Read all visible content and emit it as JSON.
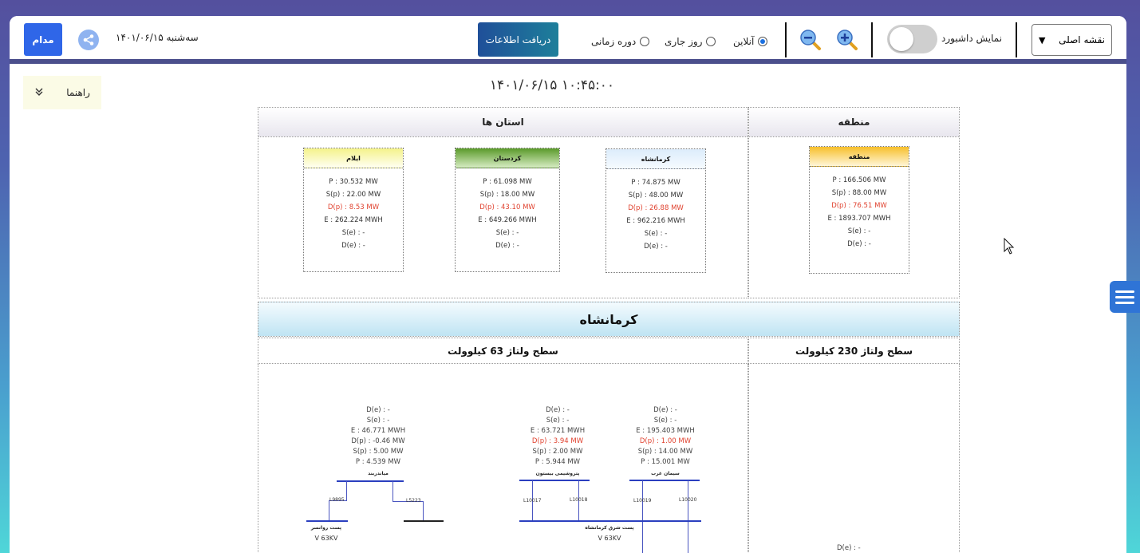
{
  "header": {
    "blue_button": "مدام",
    "date": "سه‌شنبه ۱۴۰۱/۰۶/۱۵",
    "fetch_button": "دریافت اطلاعات",
    "radio_period": "دوره زمانی",
    "radio_today": "روز جاری",
    "radio_online": "آنلاین",
    "dashboard_label": "نمایش داشبورد",
    "map_select": "نقشه اصلی"
  },
  "help_label": "راهنما",
  "timestamp": "۱۴۰۱/۰۶/۱۵ ۱۰:۴۵:۰۰",
  "sections": {
    "provinces": "استان ها",
    "region": "منطقه",
    "kermanshah": "کرمانشاه",
    "level_63": "سطح ولتاژ 63 کیلوولت",
    "level_230": "سطح ولتاژ 230 کیلوولت"
  },
  "cards": [
    {
      "title": "ایلام",
      "p": "P : 30.532 MW",
      "sp": "S(p) : 22.00 MW",
      "dp": "D(p) : 8.53 MW",
      "e": "E : 262.224 MWH",
      "se": "S(e) : -",
      "de": "D(e) : -"
    },
    {
      "title": "کردستان",
      "p": "P : 61.098 MW",
      "sp": "S(p) : 18.00 MW",
      "dp": "D(p) : 43.10 MW",
      "e": "E : 649.266 MWH",
      "se": "S(e) : -",
      "de": "D(e) : -"
    },
    {
      "title": "کرمانشاه",
      "p": "P : 74.875 MW",
      "sp": "S(p) : 48.00 MW",
      "dp": "D(p) : 26.88 MW",
      "e": "E : 962.216 MWH",
      "se": "S(e) : -",
      "de": "D(e) : -"
    },
    {
      "title": "منطقه",
      "p": "P : 166.506 MW",
      "sp": "S(p) : 88.00 MW",
      "dp": "D(p) : 76.51 MW",
      "e": "E : 1893.707 MWH",
      "se": "S(e) : -",
      "de": "D(e) : -"
    }
  ],
  "stations": [
    {
      "de": "D(e) : -",
      "se": "S(e) : -",
      "e": "E : 46.771 MWH",
      "dp": "D(p) : -0.46 MW",
      "sp": "S(p) : 5.00 MW",
      "p": "P : 4.539 MW",
      "name": "میاندربند"
    },
    {
      "de": "D(e) : -",
      "se": "S(e) : -",
      "e": "E : 63.721 MWH",
      "dp": "D(p) : 3.94 MW",
      "sp": "S(p) : 2.00 MW",
      "p": "P : 5.944 MW",
      "name": "پتروشیمی بیستون"
    },
    {
      "de": "D(e) : -",
      "se": "S(e) : -",
      "e": "E : 195.403 MWH",
      "dp": "D(p) : 1.00 MW",
      "sp": "S(p) : 14.00 MW",
      "p": "P : 15.001 MW",
      "name": "سیمان غرب"
    }
  ],
  "lines": {
    "l9895": "L9895",
    "l5223": "L5223",
    "l10017": "L10017",
    "l10018": "L10018",
    "l10019": "L10019",
    "l10020": "L10020"
  },
  "substations": {
    "rovansar": "پست روانسر",
    "rovansar_kv": "V 63KV",
    "east_ksh": "پست شرق کرمانشاه",
    "east_ksh_kv": "V 63KV"
  },
  "bottom_de": "D(e) : -"
}
